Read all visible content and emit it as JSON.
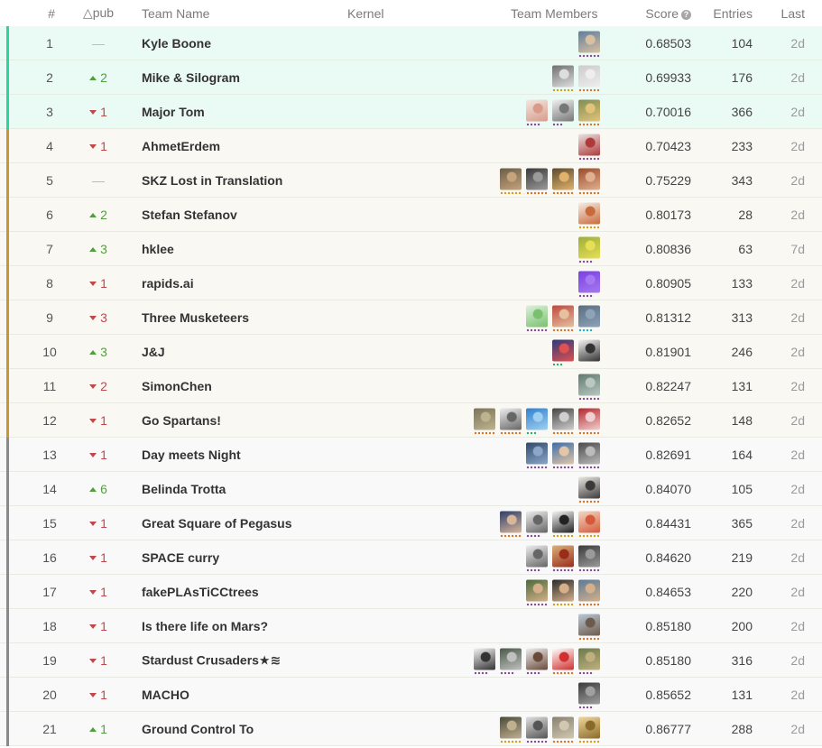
{
  "header": {
    "rank": "#",
    "delta": "△pub",
    "team_name": "Team Name",
    "kernel": "Kernel",
    "team_members": "Team Members",
    "score": "Score",
    "entries": "Entries",
    "last": "Last"
  },
  "rows": [
    {
      "rank": "1",
      "delta": "—",
      "trend": "same",
      "team": "Kyle Boone",
      "score": "0.68503",
      "entries": "104",
      "last": "2d",
      "tier": "gold",
      "members": [
        {
          "bg": "#5e7e9a",
          "accent": "#d9c0a3",
          "dots": "purple",
          "n": 3
        }
      ]
    },
    {
      "rank": "2",
      "delta": "2",
      "trend": "up",
      "team": "Mike & Silogram",
      "score": "0.69933",
      "entries": "176",
      "last": "2d",
      "tier": "gold",
      "members": [
        {
          "bg": "#6f6f6f",
          "accent": "#dedede",
          "dots": "gold",
          "n": 3
        },
        {
          "bg": "#cccccc",
          "accent": "#eeeeee",
          "dots": "orange",
          "n": 3
        }
      ]
    },
    {
      "rank": "3",
      "delta": "1",
      "trend": "down",
      "team": "Major Tom",
      "score": "0.70016",
      "entries": "366",
      "last": "2d",
      "tier": "gold",
      "members": [
        {
          "bg": "#f2e8e2",
          "accent": "#d89b8a",
          "dots": "purple",
          "n": 2
        },
        {
          "bg": "#f0f0f0",
          "accent": "#777777",
          "dots": "purple",
          "n": 1
        },
        {
          "bg": "#7e8e55",
          "accent": "#e3c37a",
          "dots": "orange",
          "n": 3
        }
      ]
    },
    {
      "rank": "4",
      "delta": "1",
      "trend": "down",
      "team": "AhmetErdem",
      "score": "0.70423",
      "entries": "233",
      "last": "2d",
      "tier": "silver",
      "members": [
        {
          "bg": "#e9e4e4",
          "accent": "#b03a3a",
          "dots": "purple",
          "n": 3
        }
      ]
    },
    {
      "rank": "5",
      "delta": "—",
      "trend": "same",
      "team": "SKZ Lost in Translation",
      "score": "0.75229",
      "entries": "343",
      "last": "2d",
      "tier": "silver",
      "members": [
        {
          "bg": "#6a5d4a",
          "accent": "#c5a37b",
          "dots": "gold",
          "n": 3
        },
        {
          "bg": "#3a3a3a",
          "accent": "#9a9a9a",
          "dots": "orange",
          "n": 3
        },
        {
          "bg": "#5b4a2f",
          "accent": "#e0b26b",
          "dots": "orange",
          "n": 3
        },
        {
          "bg": "#9a4a2a",
          "accent": "#e0b090",
          "dots": "orange",
          "n": 3
        }
      ]
    },
    {
      "rank": "6",
      "delta": "2",
      "trend": "up",
      "team": "Stefan Stefanov",
      "score": "0.80173",
      "entries": "28",
      "last": "2d",
      "tier": "silver",
      "members": [
        {
          "bg": "#f4efe8",
          "accent": "#c96a3a",
          "dots": "gold",
          "n": 3
        }
      ]
    },
    {
      "rank": "7",
      "delta": "3",
      "trend": "up",
      "team": "hklee",
      "score": "0.80836",
      "entries": "63",
      "last": "7d",
      "tier": "silver",
      "members": [
        {
          "bg": "#9cae3a",
          "accent": "#e8df56",
          "dots": "purple",
          "n": 2
        }
      ]
    },
    {
      "rank": "8",
      "delta": "1",
      "trend": "down",
      "team": "rapids.ai",
      "score": "0.80905",
      "entries": "133",
      "last": "2d",
      "tier": "silver",
      "members": [
        {
          "bg": "#7b3fe4",
          "accent": "#a57af0",
          "dots": "purple",
          "n": 2
        }
      ]
    },
    {
      "rank": "9",
      "delta": "3",
      "trend": "down",
      "team": "Three Musketeers",
      "score": "0.81312",
      "entries": "313",
      "last": "2d",
      "tier": "silver",
      "members": [
        {
          "bg": "#dff0dc",
          "accent": "#79c16f",
          "dots": "purple",
          "n": 3
        },
        {
          "bg": "#c0483c",
          "accent": "#e5c1a0",
          "dots": "orange",
          "n": 3
        },
        {
          "bg": "#5a6d80",
          "accent": "#8da3b8",
          "dots": "cyan",
          "n": 2
        }
      ]
    },
    {
      "rank": "10",
      "delta": "3",
      "trend": "up",
      "team": "J&J",
      "score": "0.81901",
      "entries": "246",
      "last": "2d",
      "tier": "silver",
      "members": [
        {
          "bg": "#2d3a7a",
          "accent": "#e05050",
          "dots": "green",
          "n": 1
        },
        {
          "bg": "#f4f4f4",
          "accent": "#333333",
          "dots": "gray",
          "n": 0
        }
      ]
    },
    {
      "rank": "11",
      "delta": "2",
      "trend": "down",
      "team": "SimonChen",
      "score": "0.82247",
      "entries": "131",
      "last": "2d",
      "tier": "silver",
      "members": [
        {
          "bg": "#5f7a70",
          "accent": "#b9c8c0",
          "dots": "purple",
          "n": 3
        }
      ]
    },
    {
      "rank": "12",
      "delta": "1",
      "trend": "down",
      "team": "Go Spartans!",
      "score": "0.82652",
      "entries": "148",
      "last": "2d",
      "tier": "silver",
      "members": [
        {
          "bg": "#7d7358",
          "accent": "#bdb48f",
          "dots": "orange",
          "n": 3
        },
        {
          "bg": "#eeeeee",
          "accent": "#666666",
          "dots": "orange",
          "n": 3
        },
        {
          "bg": "#3080d0",
          "accent": "#a0d0f0",
          "dots": "green",
          "n": 1
        },
        {
          "bg": "#454545",
          "accent": "#cfcfcf",
          "dots": "orange",
          "n": 3
        },
        {
          "bg": "#b3262b",
          "accent": "#f0d0d0",
          "dots": "orange",
          "n": 3
        }
      ]
    },
    {
      "rank": "13",
      "delta": "1",
      "trend": "down",
      "team": "Day meets Night",
      "score": "0.82691",
      "entries": "164",
      "last": "2d",
      "tier": "bronze",
      "members": [
        {
          "bg": "#2f4a6a",
          "accent": "#8aa6c8",
          "dots": "purple",
          "n": 3
        },
        {
          "bg": "#3d6ea8",
          "accent": "#e3c6a8",
          "dots": "purple",
          "n": 3
        },
        {
          "bg": "#4a4a4a",
          "accent": "#bbbbbb",
          "dots": "purple",
          "n": 3
        }
      ]
    },
    {
      "rank": "14",
      "delta": "6",
      "trend": "up",
      "team": "Belinda Trotta",
      "score": "0.84070",
      "entries": "105",
      "last": "2d",
      "tier": "bronze",
      "members": [
        {
          "bg": "#ede9e4",
          "accent": "#3a3a3a",
          "dots": "orange",
          "n": 3
        }
      ]
    },
    {
      "rank": "15",
      "delta": "1",
      "trend": "down",
      "team": "Great Square of Pegasus",
      "score": "0.84431",
      "entries": "365",
      "last": "2d",
      "tier": "bronze",
      "members": [
        {
          "bg": "#2c3e6a",
          "accent": "#d8b69a",
          "dots": "orange",
          "n": 3
        },
        {
          "bg": "#eeeeee",
          "accent": "#666666",
          "dots": "purple",
          "n": 2
        },
        {
          "bg": "#f5f5f5",
          "accent": "#222222",
          "dots": "gold",
          "n": 3
        },
        {
          "bg": "#f3d9c4",
          "accent": "#d45a3a",
          "dots": "gold",
          "n": 3
        }
      ]
    },
    {
      "rank": "16",
      "delta": "1",
      "trend": "down",
      "team": "SPACE curry",
      "score": "0.84620",
      "entries": "219",
      "last": "2d",
      "tier": "bronze",
      "members": [
        {
          "bg": "#eeeeee",
          "accent": "#666666",
          "dots": "purple",
          "n": 2
        },
        {
          "bg": "#d9b27a",
          "accent": "#9a2c1c",
          "dots": "purple",
          "n": 3
        },
        {
          "bg": "#3a3a3a",
          "accent": "#9a9a9a",
          "dots": "purple",
          "n": 3
        }
      ]
    },
    {
      "rank": "17",
      "delta": "1",
      "trend": "down",
      "team": "fakePLAsTiCCtrees",
      "score": "0.84653",
      "entries": "220",
      "last": "2d",
      "tier": "bronze",
      "members": [
        {
          "bg": "#4a6a3a",
          "accent": "#d5b08a",
          "dots": "purple",
          "n": 3
        },
        {
          "bg": "#2a2a2a",
          "accent": "#d5b08a",
          "dots": "gold",
          "n": 3
        },
        {
          "bg": "#5a7a98",
          "accent": "#d5b08a",
          "dots": "orange",
          "n": 3
        }
      ]
    },
    {
      "rank": "18",
      "delta": "1",
      "trend": "down",
      "team": "Is there life on Mars?",
      "score": "0.85180",
      "entries": "200",
      "last": "2d",
      "tier": "bronze",
      "members": [
        {
          "bg": "#b8c8d8",
          "accent": "#6e5a4a",
          "dots": "orange",
          "n": 3
        }
      ]
    },
    {
      "rank": "19",
      "delta": "1",
      "trend": "down",
      "team": "Stardust Crusaders★≋",
      "score": "0.85180",
      "entries": "316",
      "last": "2d",
      "tier": "bronze",
      "members": [
        {
          "bg": "#f4f4f4",
          "accent": "#333333",
          "dots": "purple",
          "n": 2
        },
        {
          "bg": "#4a5a4a",
          "accent": "#c0c0c0",
          "dots": "purple",
          "n": 2
        },
        {
          "bg": "#efefef",
          "accent": "#6a4a3a",
          "dots": "purple",
          "n": 2
        },
        {
          "bg": "#ffffff",
          "accent": "#d03030",
          "dots": "orange",
          "n": 3
        },
        {
          "bg": "#6a7a4a",
          "accent": "#c0b080",
          "dots": "purple",
          "n": 2
        }
      ]
    },
    {
      "rank": "20",
      "delta": "1",
      "trend": "down",
      "team": "MACHO",
      "score": "0.85652",
      "entries": "131",
      "last": "2d",
      "tier": "bronze",
      "members": [
        {
          "bg": "#3a3a3a",
          "accent": "#a0a0a0",
          "dots": "purple",
          "n": 2
        }
      ]
    },
    {
      "rank": "21",
      "delta": "1",
      "trend": "up",
      "team": "Ground Control To",
      "score": "0.86777",
      "entries": "288",
      "last": "2d",
      "tier": "bronze",
      "members": [
        {
          "bg": "#4a4a3a",
          "accent": "#c0b090",
          "dots": "gold",
          "n": 3
        },
        {
          "bg": "#e0e0e0",
          "accent": "#555555",
          "dots": "purple",
          "n": 3
        },
        {
          "bg": "#8a8070",
          "accent": "#d0c8b0",
          "dots": "orange",
          "n": 3
        },
        {
          "bg": "#f0d89a",
          "accent": "#8a6a2a",
          "dots": "gold",
          "n": 3
        }
      ]
    }
  ]
}
